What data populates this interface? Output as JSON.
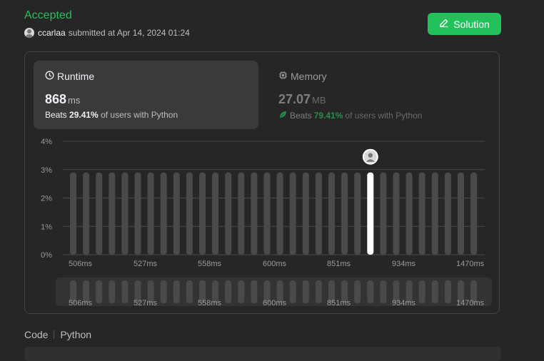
{
  "header": {
    "status": "Accepted",
    "username": "ccarlaa",
    "submitted_text": "submitted at Apr 14, 2024 01:24",
    "solution_label": "Solution"
  },
  "runtime": {
    "title": "Runtime",
    "value": "868",
    "unit": "ms",
    "beats_prefix": "Beats",
    "beats_value": "29.41%",
    "beats_suffix": "of users with Python"
  },
  "memory": {
    "title": "Memory",
    "value": "27.07",
    "unit": "MB",
    "beats_prefix": "Beats",
    "beats_value": "79.41%",
    "beats_suffix": "of users with Python"
  },
  "tabs": {
    "code": "Code",
    "language": "Python"
  },
  "colors": {
    "accent_green": "#2cbb5d",
    "button_green": "#23c15c",
    "bar_gray": "#4a4a4a",
    "highlight_bar": "#ffffff"
  },
  "chart_data": {
    "type": "bar",
    "y_ticks": [
      "4%",
      "3%",
      "2%",
      "1%",
      "0%"
    ],
    "ylim": [
      0,
      4
    ],
    "x_tick_labels": [
      "506ms",
      "527ms",
      "558ms",
      "600ms",
      "851ms",
      "934ms",
      "1470ms"
    ],
    "bar_count": 32,
    "values": [
      2.9,
      2.9,
      2.9,
      2.9,
      2.9,
      2.9,
      2.9,
      2.9,
      2.9,
      2.9,
      2.9,
      2.9,
      2.9,
      2.9,
      2.9,
      2.9,
      2.9,
      2.9,
      2.9,
      2.9,
      2.9,
      2.9,
      2.9,
      2.9,
      2.9,
      2.9,
      2.9,
      2.9,
      2.9,
      2.9,
      2.9,
      2.9
    ],
    "highlight_index": 23,
    "grid": true
  }
}
